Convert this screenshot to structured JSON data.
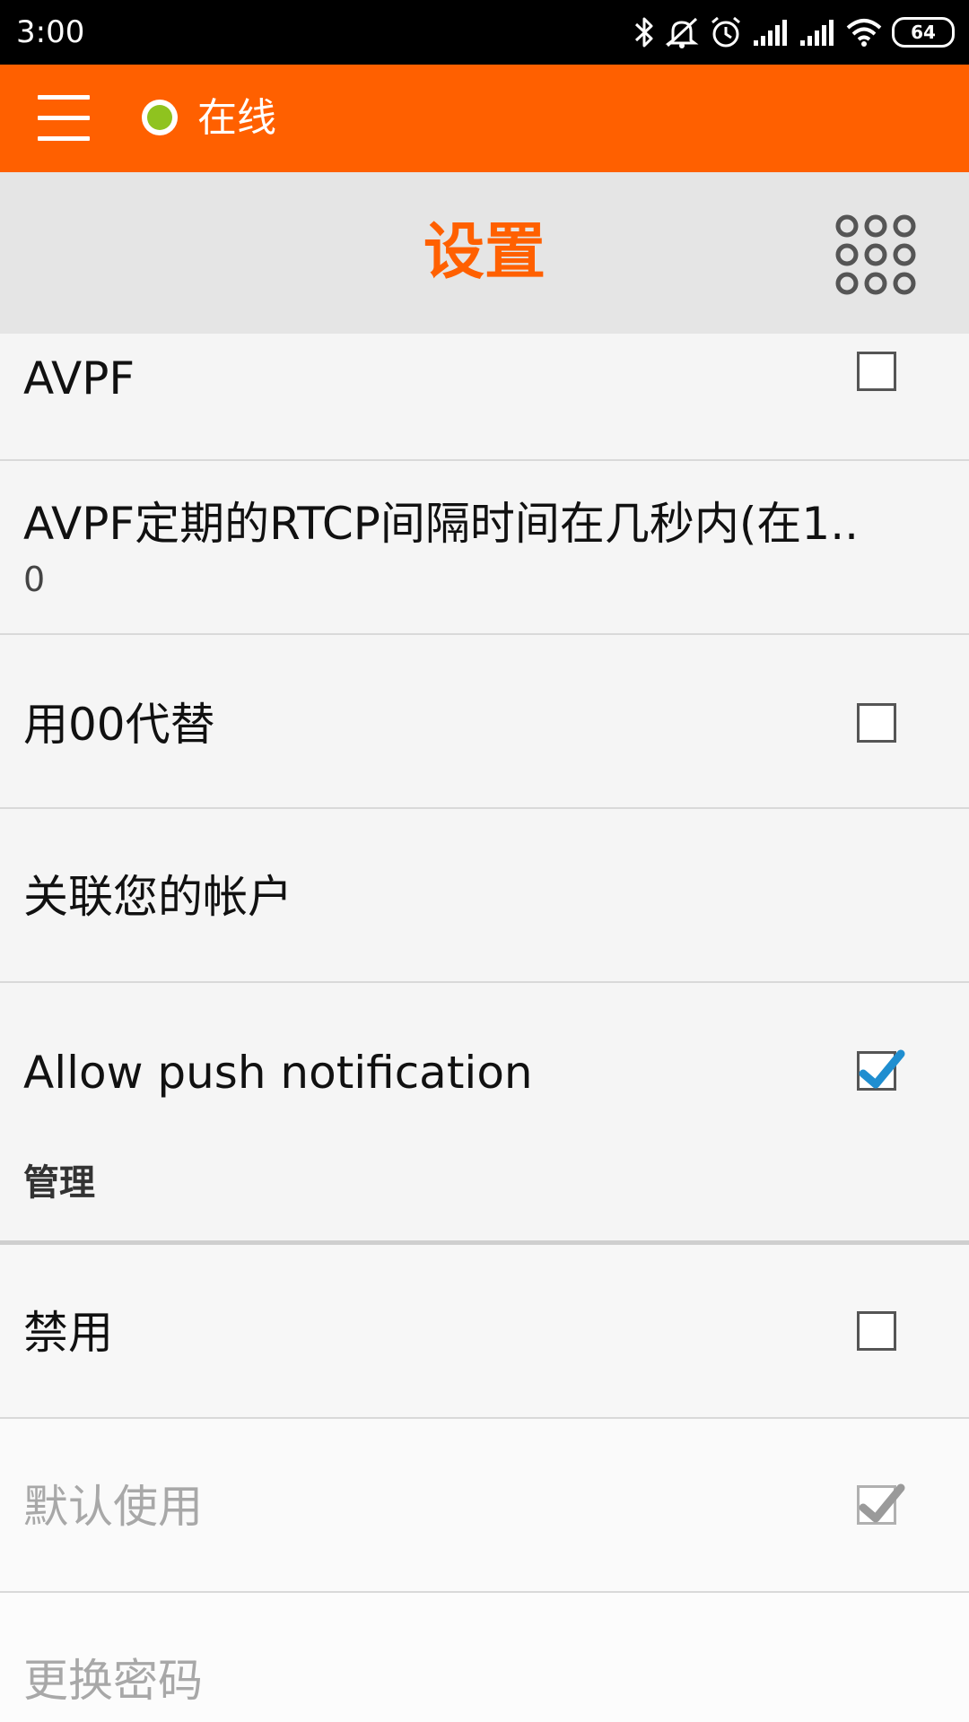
{
  "status_bar": {
    "time": "3:00",
    "battery": "64",
    "icons": [
      "bluetooth-icon",
      "mute-icon",
      "alarm-icon",
      "signal-icon",
      "signal-icon",
      "wifi-icon",
      "battery-icon"
    ]
  },
  "action_bar": {
    "menu_icon": "hamburger-menu-icon",
    "presence_status": "在线",
    "presence_color": "#8fc31f",
    "background": "#ff6000"
  },
  "title_bar": {
    "title": "设置",
    "dialpad_icon": "dialpad-icon",
    "accent": "#ff6000"
  },
  "settings": {
    "avpf": {
      "title": "AVPF",
      "checked": false
    },
    "rtcp": {
      "title": "AVPF定期的RTCP间隔时间在几秒内(在1..",
      "summary": "0"
    },
    "replace_plus": {
      "title": "用00代替",
      "checked": false
    },
    "link_account": {
      "title": "关联您的帐户"
    },
    "push": {
      "title": "Allow push notification",
      "checked": true
    },
    "manage_category": {
      "title": "管理"
    },
    "disable": {
      "title": "禁用",
      "checked": false
    },
    "default_use": {
      "title": "默认使用",
      "checked": true,
      "enabled": false
    },
    "change_password": {
      "title": "更换密码",
      "enabled": false
    }
  }
}
